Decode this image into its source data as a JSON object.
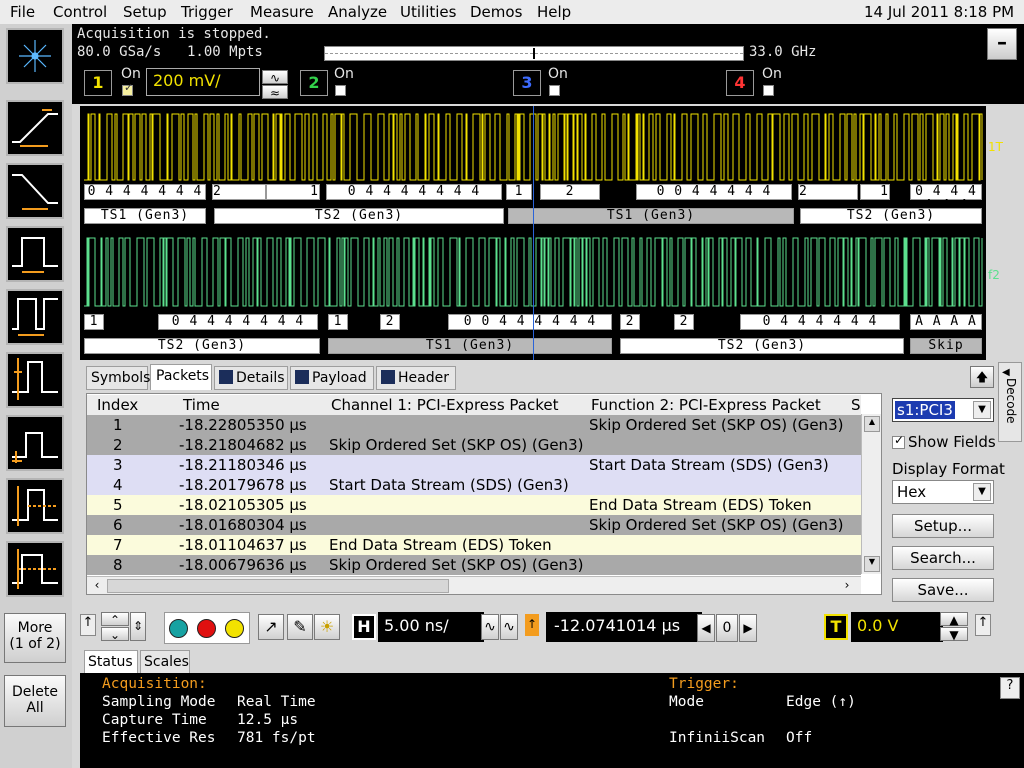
{
  "menu": [
    "File",
    "Control",
    "Setup",
    "Trigger",
    "Measure",
    "Analyze",
    "Utilities",
    "Demos",
    "Help"
  ],
  "datetime": "14 Jul 2011  8:18 PM",
  "acquisition": {
    "status": "Acquisition is stopped.",
    "sample_rate": "80.0 GSa/s",
    "memory": "1.00 Mpts",
    "bandwidth": "33.0 GHz"
  },
  "channels": [
    {
      "number": "1",
      "on_label": "On",
      "checked": true,
      "scale": "200 mV/",
      "color": "#f2e200"
    },
    {
      "number": "2",
      "on_label": "On",
      "checked": false,
      "color": "#32d04a"
    },
    {
      "number": "3",
      "on_label": "On",
      "checked": false,
      "color": "#3d6bff"
    },
    {
      "number": "4",
      "on_label": "On",
      "checked": false,
      "color": "#ff3434"
    }
  ],
  "waveform": {
    "ch1_marker": "1T",
    "f2_marker": "f2",
    "lane1_symbols": [
      "0 4 4 4 4 4 4",
      "2",
      "1",
      "0 4 4 4 4 4 4 4",
      "1",
      "2",
      "0 0 4 4 4 4 4",
      "2",
      "1",
      "0 4 4 4 4 4 4"
    ],
    "lane1_packets": [
      "TS1 (Gen3)",
      "TS2 (Gen3)",
      "TS1 (Gen3)",
      "TS2 (Gen3)"
    ],
    "lane2_symbols": [
      "1",
      "0 4 4 4 4 4 4 4",
      "1",
      "2",
      "0 0 4 4 4 4 4 4",
      "2",
      "2",
      "0 4 4 4 4 4 4",
      "A A A A"
    ],
    "lane2_packets": [
      "TS2 (Gen3)",
      "TS1 (Gen3)",
      "TS2 (Gen3)",
      "Skip"
    ]
  },
  "tabs": {
    "symbols": "Symbols",
    "packets": "Packets",
    "details": "Details",
    "payload": "Payload",
    "header": "Header",
    "decode": "Decode"
  },
  "table": {
    "columns": [
      "Index",
      "Time",
      "Channel 1: PCI-Express Packet",
      "Function 2: PCI-Express Packet",
      "S"
    ],
    "rows": [
      {
        "index": "1",
        "time": "-18.22805350 µs",
        "ch1": "",
        "f2": "Skip Ordered Set (SKP OS) (Gen3)",
        "style": "gray"
      },
      {
        "index": "2",
        "time": "-18.21804682 µs",
        "ch1": "Skip Ordered Set (SKP OS) (Gen3)",
        "f2": "",
        "style": "gray"
      },
      {
        "index": "3",
        "time": "-18.21180346 µs",
        "ch1": "",
        "f2": "Start Data Stream (SDS) (Gen3)",
        "style": "lav"
      },
      {
        "index": "4",
        "time": "-18.20179678 µs",
        "ch1": "Start Data Stream (SDS) (Gen3)",
        "f2": "",
        "style": "lav"
      },
      {
        "index": "5",
        "time": "-18.02105305 µs",
        "ch1": "",
        "f2": "End Data Stream (EDS) Token",
        "style": "yel"
      },
      {
        "index": "6",
        "time": "-18.01680304 µs",
        "ch1": "",
        "f2": "Skip Ordered Set (SKP OS) (Gen3)",
        "style": "gray"
      },
      {
        "index": "7",
        "time": "-18.01104637 µs",
        "ch1": "End Data Stream (EDS) Token",
        "f2": "",
        "style": "yel"
      },
      {
        "index": "8",
        "time": "-18.00679636 µs",
        "ch1": "Skip Ordered Set (SKP OS) (Gen3)",
        "f2": "",
        "style": "gray"
      }
    ]
  },
  "right_panel": {
    "source": "s1:PCI3",
    "show_fields": "Show Fields",
    "display_format_label": "Display Format",
    "display_format": "Hex",
    "setup": "Setup...",
    "search": "Search...",
    "save": "Save..."
  },
  "controls": {
    "h_label": "H",
    "timebase": "5.00 ns/",
    "delay": "-12.0741014 µs",
    "zero": "0",
    "t_label": "T",
    "trigger_level": "0.0 V"
  },
  "sidebar": {
    "more": "More\n(1 of 2)",
    "more_line1": "More",
    "more_line2": "(1 of 2)",
    "delete_line1": "Delete",
    "delete_line2": "All"
  },
  "status_tabs": {
    "status": "Status",
    "scales": "Scales"
  },
  "status": {
    "acq_title": "Acquisition:",
    "sampling_mode_label": "Sampling Mode",
    "sampling_mode": "Real Time",
    "capture_time_label": "Capture Time",
    "capture_time": "12.5 µs",
    "eff_res_label": "Effective Res",
    "eff_res": "781 fs/pt",
    "trigger_title": "Trigger:",
    "mode_label": "Mode",
    "mode": "Edge (↑)",
    "infiniiscan_label": "InfiniiScan",
    "infiniiscan": "Off"
  }
}
